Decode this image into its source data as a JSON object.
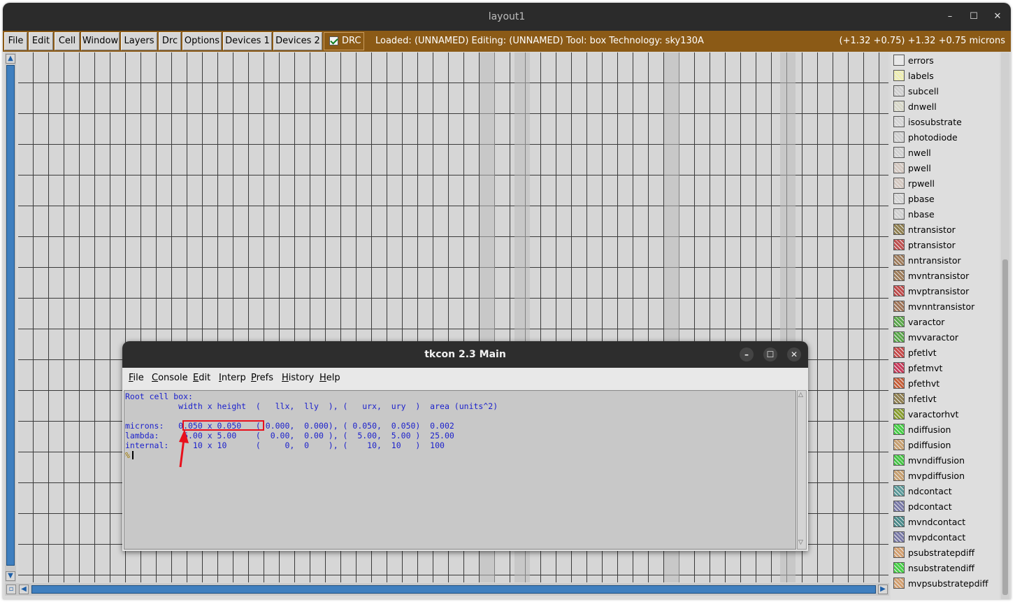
{
  "window": {
    "title": "layout1",
    "controls": [
      "–",
      "☐",
      "✕"
    ]
  },
  "menubar": {
    "items": [
      "File",
      "Edit",
      "Cell",
      "Window",
      "Layers",
      "Drc",
      "Options",
      "Devices 1",
      "Devices 2"
    ],
    "drc_toggle": {
      "label": "DRC",
      "checked": true
    },
    "status": "Loaded: (UNNAMED) Editing: (UNNAMED) Tool: box  Technology: sky130A",
    "coords": "(+1.32 +0.75) +1.32 +0.75 microns"
  },
  "layers": [
    {
      "name": "errors",
      "color": "#e8e8e8"
    },
    {
      "name": "labels",
      "color": "#efefb0"
    },
    {
      "name": "subcell",
      "color": "#cfcfcf"
    },
    {
      "name": "dnwell",
      "color": "#d8d8c8"
    },
    {
      "name": "isosubstrate",
      "color": "#d4d4d4"
    },
    {
      "name": "photodiode",
      "color": "#d0d0d0"
    },
    {
      "name": "nwell",
      "color": "#d0d0d0"
    },
    {
      "name": "pwell",
      "color": "#d4c8c0"
    },
    {
      "name": "rpwell",
      "color": "#d4c8c0"
    },
    {
      "name": "pbase",
      "color": "#d4d4d4"
    },
    {
      "name": "nbase",
      "color": "#d0d0d0"
    },
    {
      "name": "ntransistor",
      "color": "#8f7f4f"
    },
    {
      "name": "ptransistor",
      "color": "#c05050"
    },
    {
      "name": "nntransistor",
      "color": "#a07d5c"
    },
    {
      "name": "mvntransistor",
      "color": "#9e7d5a"
    },
    {
      "name": "mvptransistor",
      "color": "#c04a4a"
    },
    {
      "name": "mvnntransistor",
      "color": "#a07558"
    },
    {
      "name": "varactor",
      "color": "#5aa84a"
    },
    {
      "name": "mvvaractor",
      "color": "#5aa84a"
    },
    {
      "name": "pfetlvt",
      "color": "#c84a4a"
    },
    {
      "name": "pfetmvt",
      "color": "#c83a5a"
    },
    {
      "name": "pfethvt",
      "color": "#c8603a"
    },
    {
      "name": "nfetlvt",
      "color": "#8f7f4f"
    },
    {
      "name": "varactorhvt",
      "color": "#8aa030"
    },
    {
      "name": "ndiffusion",
      "color": "#46d046"
    },
    {
      "name": "pdiffusion",
      "color": "#c8a070"
    },
    {
      "name": "mvndiffusion",
      "color": "#46c846"
    },
    {
      "name": "mvpdiffusion",
      "color": "#c8a070"
    },
    {
      "name": "ndcontact",
      "color": "#5a9a9a"
    },
    {
      "name": "pdcontact",
      "color": "#7a7aa8"
    },
    {
      "name": "mvndcontact",
      "color": "#4a8a8a"
    },
    {
      "name": "mvpdcontact",
      "color": "#7a7aa8"
    },
    {
      "name": "psubstratepdiff",
      "color": "#d4a070"
    },
    {
      "name": "nsubstratendiff",
      "color": "#46d046"
    },
    {
      "name": "mvpsubstratepdiff",
      "color": "#d4a070"
    }
  ],
  "tkcon": {
    "title": "tkcon 2.3 Main",
    "controls": [
      "–",
      "☐",
      "✕"
    ],
    "menu": [
      {
        "label": "File",
        "u": "F",
        "rest": "ile"
      },
      {
        "label": "Console",
        "u": "C",
        "rest": "onsole"
      },
      {
        "label": "Edit",
        "u": "E",
        "rest": "dit"
      },
      {
        "label": "Interp",
        "u": "I",
        "rest": "nterp"
      },
      {
        "label": "Prefs",
        "u": "P",
        "rest": "refs"
      },
      {
        "label": "History",
        "u": "H",
        "rest": "istory"
      },
      {
        "label": "Help",
        "u": "H",
        "rest": "elp"
      }
    ],
    "output_lines": [
      "Root cell box:",
      "           width x height  (   llx,  lly  ), (   urx,  ury  )  area (units^2)",
      "",
      "microns:   0.050 x 0.050   ( 0.000,  0.000), ( 0.050,  0.050)  0.002",
      "lambda:     5.00 x 5.00    (  0.00,  0.00 ), (  5.00,  5.00 )  25.00",
      "internal:     10 x 10      (     0,  0    ), (    10,  10   )  100"
    ],
    "prompt": "%"
  }
}
